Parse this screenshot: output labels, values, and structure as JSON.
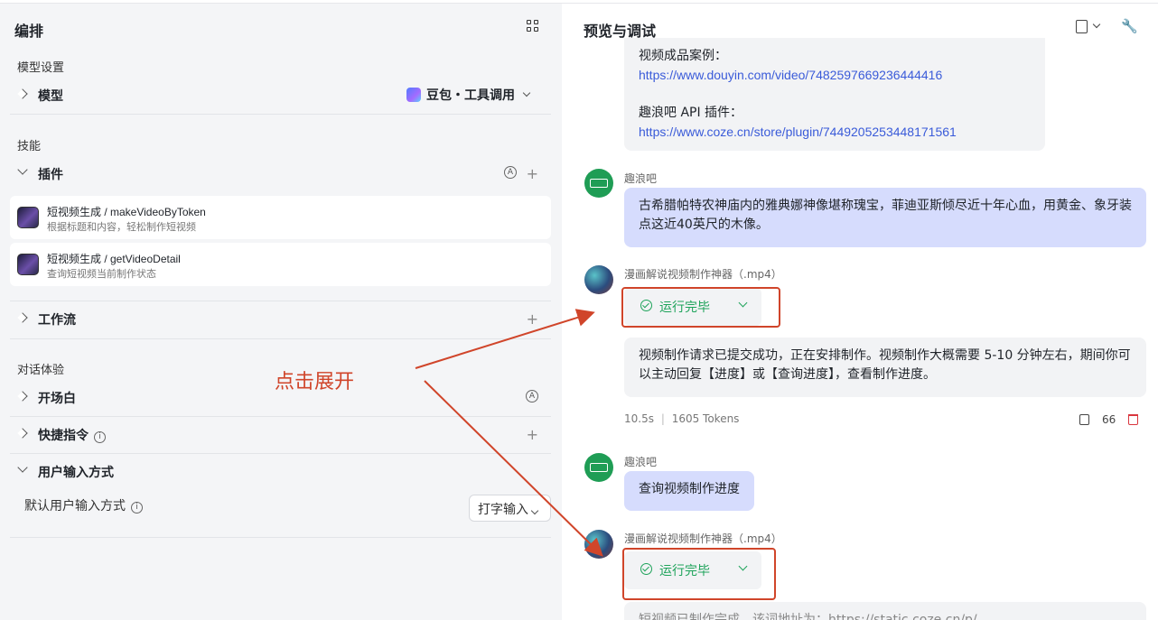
{
  "left": {
    "title": "编排",
    "model_section": "模型设置",
    "model_label": "模型",
    "model_value": "豆包・工具调用",
    "skills_section": "技能",
    "plugins_label": "插件",
    "plugins": [
      {
        "name": "短视频生成 / makeVideoByToken",
        "desc": "根据标题和内容，轻松制作短视频"
      },
      {
        "name": "短视频生成 / getVideoDetail",
        "desc": "查询短视频当前制作状态"
      }
    ],
    "workflow_label": "工作流",
    "chat_section": "对话体验",
    "opening_label": "开场白",
    "shortcut_label": "快捷指令",
    "input_mode_label": "用户输入方式",
    "default_input_label": "默认用户输入方式",
    "default_input_value": "打字输入",
    "circle_a": "A",
    "plus": "+",
    "info": "i"
  },
  "right": {
    "title": "预览与调试",
    "msg1": {
      "case_label": "视频成品案例：",
      "case_link": "https://www.douyin.com/video/7482597669236444416",
      "plugin_label": "趣浪吧 API 插件：",
      "plugin_link": "https://www.coze.cn/store/plugin/7449205253448171561"
    },
    "user_name": "趣浪吧",
    "user_msg1": "古希腊帕特农神庙内的雅典娜神像堪称瑰宝，菲迪亚斯倾尽近十年心血，用黄金、象牙装点这近40英尺的木像。",
    "bot_name": "漫画解说视频制作神器（.mp4）",
    "run_status": "运行完毕",
    "bot_msg1": "视频制作请求已提交成功，正在安排制作。视频制作大概需要 5-10 分钟左右，期间你可以主动回复【进度】或【查询进度】，查看制作进度。",
    "meta_time": "10.5s",
    "meta_sep": "|",
    "meta_tokens": "1605 Tokens",
    "quote_icon": "66",
    "user_msg2": "查询视频制作进度",
    "bot_msg2_partial": "短视频已制作完成，该词地址为：https://static.coze.cn/p/..."
  },
  "annotation": {
    "text": "点击展开",
    "color": "#d0452a"
  },
  "colors": {
    "success": "#1ea35a",
    "link": "#3a5bd9",
    "user_bubble": "#d6dcfd",
    "panel_bg": "#f4f5f7"
  }
}
